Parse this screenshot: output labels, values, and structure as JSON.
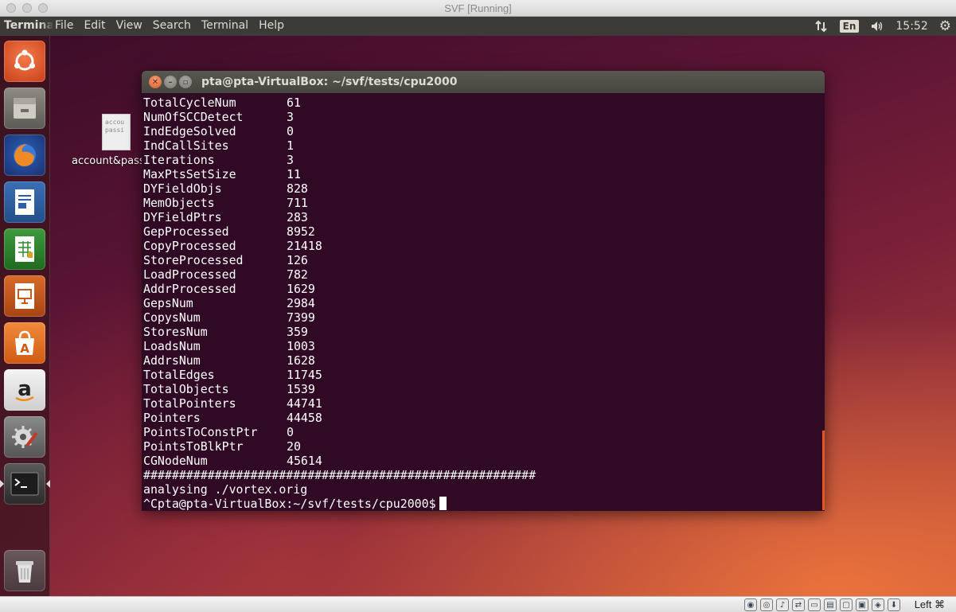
{
  "host_window": {
    "title": "SVF [Running]"
  },
  "top_panel": {
    "app_name": "Terminal",
    "menu": [
      "File",
      "Edit",
      "View",
      "Search",
      "Terminal",
      "Help"
    ],
    "keyboard_lang": "En",
    "clock": "15:52",
    "icons": [
      "network-arrows-icon",
      "volume-icon",
      "gear-icon"
    ]
  },
  "launcher": {
    "items": [
      {
        "name": "dash-home-icon"
      },
      {
        "name": "files-icon"
      },
      {
        "name": "firefox-icon"
      },
      {
        "name": "libreoffice-writer-icon"
      },
      {
        "name": "libreoffice-calc-icon"
      },
      {
        "name": "libreoffice-impress-icon"
      },
      {
        "name": "software-center-icon"
      },
      {
        "name": "amazon-icon"
      },
      {
        "name": "system-settings-icon"
      },
      {
        "name": "terminal-icon"
      },
      {
        "name": "trash-icon"
      }
    ]
  },
  "desktop_file": {
    "label": "account&pass",
    "preview_lines": [
      "accou",
      "passi"
    ]
  },
  "terminal": {
    "title": "pta@pta-VirtualBox: ~/svf/tests/cpu2000",
    "stats": [
      {
        "name": "TotalCycleNum",
        "value": "61"
      },
      {
        "name": "NumOfSCCDetect",
        "value": "3"
      },
      {
        "name": "IndEdgeSolved",
        "value": "0"
      },
      {
        "name": "IndCallSites",
        "value": "1"
      },
      {
        "name": "Iterations",
        "value": "3"
      },
      {
        "name": "MaxPtsSetSize",
        "value": "11"
      },
      {
        "name": "DYFieldObjs",
        "value": "828"
      },
      {
        "name": "MemObjects",
        "value": "711"
      },
      {
        "name": "DYFieldPtrs",
        "value": "283"
      },
      {
        "name": "GepProcessed",
        "value": "8952"
      },
      {
        "name": "CopyProcessed",
        "value": "21418"
      },
      {
        "name": "StoreProcessed",
        "value": "126"
      },
      {
        "name": "LoadProcessed",
        "value": "782"
      },
      {
        "name": "AddrProcessed",
        "value": "1629"
      },
      {
        "name": "GepsNum",
        "value": "2984"
      },
      {
        "name": "CopysNum",
        "value": "7399"
      },
      {
        "name": "StoresNum",
        "value": "359"
      },
      {
        "name": "LoadsNum",
        "value": "1003"
      },
      {
        "name": "AddrsNum",
        "value": "1628"
      },
      {
        "name": "TotalEdges",
        "value": "11745"
      },
      {
        "name": "TotalObjects",
        "value": "1539"
      },
      {
        "name": "TotalPointers",
        "value": "44741"
      },
      {
        "name": "Pointers",
        "value": "44458"
      },
      {
        "name": "PointsToConstPtr",
        "value": "0"
      },
      {
        "name": "PointsToBlkPtr",
        "value": "20"
      },
      {
        "name": "CGNodeNum",
        "value": "45614"
      }
    ],
    "separator": "#######################################################",
    "analysing_line": "analysing ./vortex.orig",
    "prompt": "^Cpta@pta-VirtualBox:~/svf/tests/cpu2000$"
  },
  "vbox_statusbar": {
    "host_key": "Left ⌘"
  }
}
